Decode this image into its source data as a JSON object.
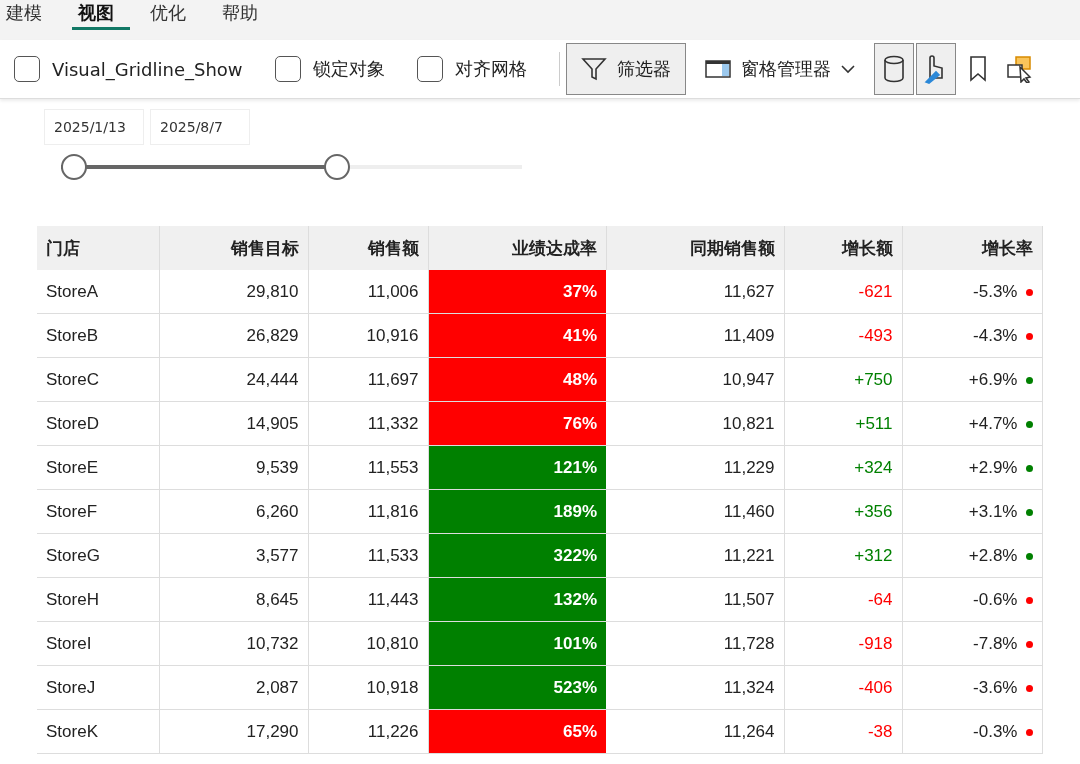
{
  "menu_tabs": [
    {
      "label": "建模",
      "selected": false
    },
    {
      "label": "视图",
      "selected": true
    },
    {
      "label": "优化",
      "selected": false
    },
    {
      "label": "帮助",
      "selected": false
    }
  ],
  "toolbar": {
    "checkboxes": [
      {
        "label": "Visual_Gridline_Show",
        "checked": false
      },
      {
        "label": "锁定对象",
        "checked": false
      },
      {
        "label": "对齐网格",
        "checked": false
      }
    ],
    "filter_button": {
      "label": "筛选器",
      "pressed": true
    },
    "pane_button": {
      "label": "窗格管理器",
      "pressed": false
    },
    "icon_buttons": [
      {
        "pressed": true
      },
      {
        "pressed": true
      },
      {
        "pressed": false
      },
      {
        "pressed": false
      }
    ]
  },
  "date_slicer": {
    "start": "2025/1/13",
    "end": "2025/8/7",
    "level": 0.587
  },
  "table": {
    "columns": [
      "门店",
      "销售目标",
      "销售额",
      "业绩达成率",
      "同期销售额",
      "增长额",
      "增长率"
    ],
    "rows": [
      {
        "store": "StoreA",
        "target": "29,810",
        "sales": "11,006",
        "rate": "37%",
        "color": "#ff0000",
        "prior": "11,627",
        "growth": "-621",
        "growth_rate": "-5.3%",
        "rising": false
      },
      {
        "store": "StoreB",
        "target": "26,829",
        "sales": "10,916",
        "rate": "41%",
        "color": "#ff0000",
        "prior": "11,409",
        "growth": "-493",
        "growth_rate": "-4.3%",
        "rising": false
      },
      {
        "store": "StoreC",
        "target": "24,444",
        "sales": "11,697",
        "rate": "48%",
        "color": "#ff0000",
        "prior": "10,947",
        "growth": "+750",
        "growth_rate": "+6.9%",
        "rising": true
      },
      {
        "store": "StoreD",
        "target": "14,905",
        "sales": "11,332",
        "rate": "76%",
        "color": "#ff0000",
        "prior": "10,821",
        "growth": "+511",
        "growth_rate": "+4.7%",
        "rising": true
      },
      {
        "store": "StoreE",
        "target": "9,539",
        "sales": "11,553",
        "rate": "121%",
        "color": "#008000",
        "prior": "11,229",
        "growth": "+324",
        "growth_rate": "+2.9%",
        "rising": true
      },
      {
        "store": "StoreF",
        "target": "6,260",
        "sales": "11,816",
        "rate": "189%",
        "color": "#008000",
        "prior": "11,460",
        "growth": "+356",
        "growth_rate": "+3.1%",
        "rising": true
      },
      {
        "store": "StoreG",
        "target": "3,577",
        "sales": "11,533",
        "rate": "322%",
        "color": "#008000",
        "prior": "11,221",
        "growth": "+312",
        "growth_rate": "+2.8%",
        "rising": true
      },
      {
        "store": "StoreH",
        "target": "8,645",
        "sales": "11,443",
        "rate": "132%",
        "color": "#008000",
        "prior": "11,507",
        "growth": "-64",
        "growth_rate": "-0.6%",
        "rising": false
      },
      {
        "store": "StoreI",
        "target": "10,732",
        "sales": "10,810",
        "rate": "101%",
        "color": "#008000",
        "prior": "11,728",
        "growth": "-918",
        "growth_rate": "-7.8%",
        "rising": false
      },
      {
        "store": "StoreJ",
        "target": "2,087",
        "sales": "10,918",
        "rate": "523%",
        "color": "#008000",
        "prior": "11,324",
        "growth": "-406",
        "growth_rate": "-3.6%",
        "rising": false
      },
      {
        "store": "StoreK",
        "target": "17,290",
        "sales": "11,226",
        "rate": "65%",
        "color": "#ff0000",
        "prior": "11,264",
        "growth": "-38",
        "growth_rate": "-0.3%",
        "rising": false
      }
    ]
  }
}
